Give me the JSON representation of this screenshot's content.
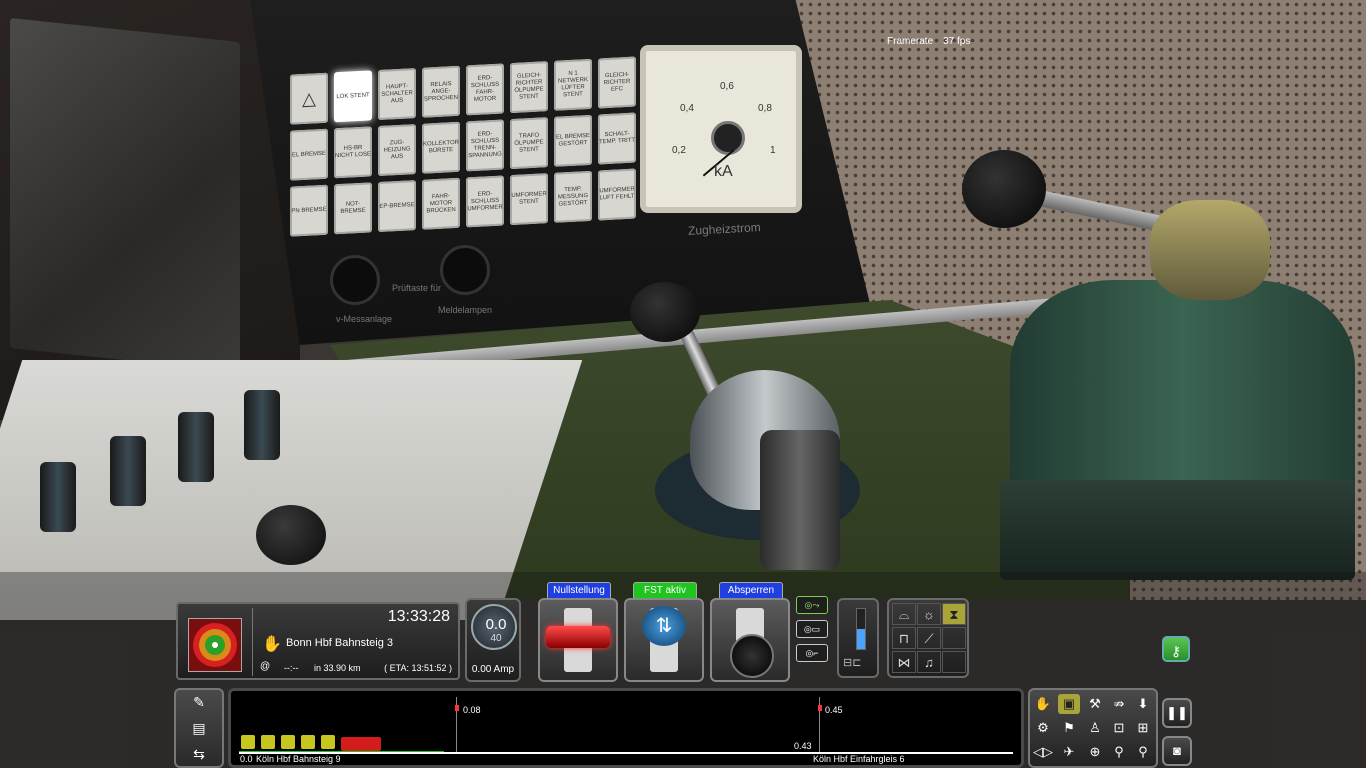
{
  "overlay": {
    "framerate_label": "Framerate",
    "framerate_value": "37 fps"
  },
  "cab": {
    "annunciator_keys": [
      "",
      "LOK STENT",
      "HAUPT-SCHALTER AUS",
      "RELAIS ANGE-SPROCHEN",
      "ERD-SCHLUSS FAHR-MOTOR",
      "GLEICH-RICHTER ÖLPUMPE STENT",
      "N 1 NETWERK LÜFTER STENT",
      "GLEICH-RICHTER EFC",
      "EL BREMSE",
      "HS-BR NICHT LOSE",
      "ZUG-HEIZUNG AUS",
      "KOLLEKTOR BÜRSTE",
      "ERD-SCHLUSS TRENN-SPANNUNG",
      "TRAFO ÖLPUMPE STENT",
      "EL BREMSE GESTÖRT",
      "SCHALT-TEMP. TRITT",
      "PN BREMSE",
      "NOT-BREMSE",
      "EP-BREMSE",
      "FAHR-MOTOR BRÜCKEN",
      "ERD-SCHLUSS UMFORMER",
      "UMFORMER STENT",
      "TEMP. MESSUNG GESTÖRT",
      "UMFORMER LUFT FEHLT"
    ],
    "gauge": {
      "ticks": [
        "0,4",
        "0,6",
        "0,8",
        "0,2",
        "1"
      ],
      "unit": "kA",
      "caption": "Zugheizstrom"
    },
    "labels": {
      "pruef": "Prüftaste für",
      "melde": "Meldelampen",
      "vmess": "v-Messanlage"
    }
  },
  "hud": {
    "next_signal": {
      "time": "13:33:28",
      "destination": "Bonn Hbf Bahnsteig 3",
      "at_symbol": "@",
      "arrival_time": "--:--",
      "distance": "in 33.90 km",
      "eta": "( ETA: 13:51:52 )"
    },
    "speed": {
      "value": "0.0",
      "limit": "40",
      "amperage": "0.00 Amp"
    },
    "controls": [
      {
        "label": "Nullstellung",
        "label_color": "#1f3fe0"
      },
      {
        "label": "FST aktiv",
        "label_color": "#1ec51e"
      },
      {
        "label": "Absperren",
        "label_color": "#1f3fe0"
      }
    ],
    "track_monitor": {
      "signals": [
        {
          "distance": "0.08"
        },
        {
          "distance": "0.45"
        }
      ],
      "marker": "0.43",
      "start_km": "0.0",
      "start_station": "Köln Hbf Bahnsteig 9",
      "end_station": "Köln Hbf Einfahrgleis 6"
    },
    "throttle_level": 0.5,
    "icons": {
      "nextsig_hand": "hand-stop-icon",
      "pause": "pause-icon",
      "screenshot": "camera-icon",
      "key": "key-icon"
    }
  }
}
